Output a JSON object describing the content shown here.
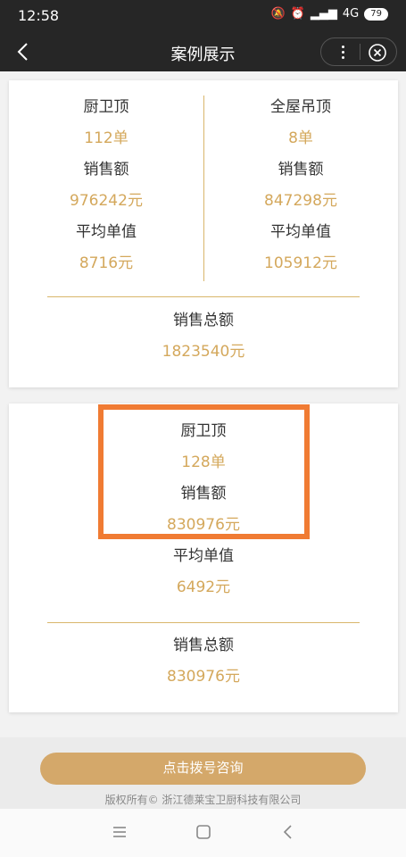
{
  "status_bar": {
    "time": "12:58",
    "network": "4G",
    "battery": "79"
  },
  "nav": {
    "title": "案例展示"
  },
  "card1": {
    "left": {
      "category": "厨卫顶",
      "count": "112单",
      "sales_label": "销售额",
      "sales": "976242元",
      "avg_label": "平均单值",
      "avg": "8716元"
    },
    "right": {
      "category": "全屋吊顶",
      "count": "8单",
      "sales_label": "销售额",
      "sales": "847298元",
      "avg_label": "平均单值",
      "avg": "105912元"
    },
    "total_label": "销售总额",
    "total": "1823540元"
  },
  "card2": {
    "category": "厨卫顶",
    "count": "128单",
    "sales_label": "销售额",
    "sales": "830976元",
    "avg_label": "平均单值",
    "avg": "6492元",
    "total_label": "销售总额",
    "total": "830976元"
  },
  "footer": {
    "button": "点击拨号咨询",
    "copyright": "版权所有© 浙江德莱宝卫厨科技有限公司"
  },
  "colors": {
    "accent": "#d4a85c",
    "highlight": "#f07b33",
    "bar": "#262626",
    "button": "#d4a86a"
  },
  "icons": [
    "back-icon",
    "more-icon",
    "close-icon",
    "menu-icon",
    "home-icon",
    "back-nav-icon"
  ]
}
